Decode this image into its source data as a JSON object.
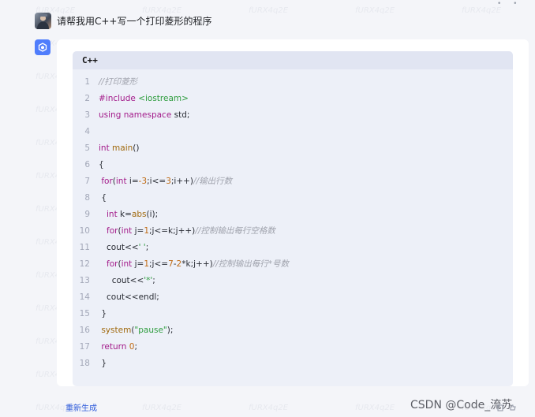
{
  "watermark": "fURX4q2E",
  "user_message": {
    "text": "请帮我用C++写一个打印菱形的程序"
  },
  "code_block": {
    "language": "C++",
    "lines": [
      {
        "n": "1",
        "tokens": [
          {
            "t": "//打印菱形",
            "c": "c"
          }
        ]
      },
      {
        "n": "2",
        "tokens": [
          {
            "t": "#include ",
            "c": "k"
          },
          {
            "t": "<iostream>",
            "c": "s"
          }
        ]
      },
      {
        "n": "3",
        "tokens": [
          {
            "t": "using namespace ",
            "c": "k"
          },
          {
            "t": "std;",
            "c": "p"
          }
        ]
      },
      {
        "n": "4",
        "tokens": []
      },
      {
        "n": "5",
        "tokens": [
          {
            "t": "int ",
            "c": "k"
          },
          {
            "t": "main",
            "c": "f"
          },
          {
            "t": "()",
            "c": "p"
          }
        ]
      },
      {
        "n": "6",
        "tokens": [
          {
            "t": "{",
            "c": "p"
          }
        ]
      },
      {
        "n": "7",
        "tokens": [
          {
            "t": " for",
            "c": "k"
          },
          {
            "t": "(",
            "c": "p"
          },
          {
            "t": "int ",
            "c": "k"
          },
          {
            "t": "i=",
            "c": "p"
          },
          {
            "t": "-3",
            "c": "n"
          },
          {
            "t": ";i<=",
            "c": "p"
          },
          {
            "t": "3",
            "c": "n"
          },
          {
            "t": ";i++)",
            "c": "p"
          },
          {
            "t": "//输出行数",
            "c": "c"
          }
        ]
      },
      {
        "n": "8",
        "tokens": [
          {
            "t": " {",
            "c": "p"
          }
        ]
      },
      {
        "n": "9",
        "tokens": [
          {
            "t": "   int ",
            "c": "k"
          },
          {
            "t": "k=",
            "c": "p"
          },
          {
            "t": "abs",
            "c": "f"
          },
          {
            "t": "(i);",
            "c": "p"
          }
        ]
      },
      {
        "n": "10",
        "tokens": [
          {
            "t": "   for",
            "c": "k"
          },
          {
            "t": "(",
            "c": "p"
          },
          {
            "t": "int ",
            "c": "k"
          },
          {
            "t": "j=",
            "c": "p"
          },
          {
            "t": "1",
            "c": "n"
          },
          {
            "t": ";j<=k;j++)",
            "c": "p"
          },
          {
            "t": "//控制输出每行空格数",
            "c": "c"
          }
        ]
      },
      {
        "n": "11",
        "tokens": [
          {
            "t": "   cout<<",
            "c": "p"
          },
          {
            "t": "' '",
            "c": "s"
          },
          {
            "t": ";",
            "c": "p"
          }
        ]
      },
      {
        "n": "12",
        "tokens": [
          {
            "t": "   for",
            "c": "k"
          },
          {
            "t": "(",
            "c": "p"
          },
          {
            "t": "int ",
            "c": "k"
          },
          {
            "t": "j=",
            "c": "p"
          },
          {
            "t": "1",
            "c": "n"
          },
          {
            "t": ";j<=",
            "c": "p"
          },
          {
            "t": "7",
            "c": "n"
          },
          {
            "t": "-",
            "c": "p"
          },
          {
            "t": "2",
            "c": "n"
          },
          {
            "t": "*k;j++)",
            "c": "p"
          },
          {
            "t": "//控制输出每行*号数",
            "c": "c"
          }
        ]
      },
      {
        "n": "13",
        "tokens": [
          {
            "t": "     cout<<",
            "c": "p"
          },
          {
            "t": "'*'",
            "c": "s"
          },
          {
            "t": ";",
            "c": "p"
          }
        ]
      },
      {
        "n": "14",
        "tokens": [
          {
            "t": "   cout<<endl;",
            "c": "p"
          }
        ]
      },
      {
        "n": "15",
        "tokens": [
          {
            "t": " }",
            "c": "p"
          }
        ]
      },
      {
        "n": "16",
        "tokens": [
          {
            "t": " system",
            "c": "f"
          },
          {
            "t": "(",
            "c": "p"
          },
          {
            "t": "\"pause\"",
            "c": "s"
          },
          {
            "t": ");",
            "c": "p"
          }
        ]
      },
      {
        "n": "17",
        "tokens": [
          {
            "t": " return ",
            "c": "k"
          },
          {
            "t": "0",
            "c": "n"
          },
          {
            "t": ";",
            "c": "p"
          }
        ]
      },
      {
        "n": "18",
        "tokens": [
          {
            "t": " }",
            "c": "p"
          }
        ]
      }
    ]
  },
  "actions": {
    "regenerate": "重新生成"
  },
  "footer": {
    "csdn": "CSDN @Code_流苏"
  },
  "colors": {
    "accent": "#4f7dfc",
    "link": "#2e5bdb"
  }
}
